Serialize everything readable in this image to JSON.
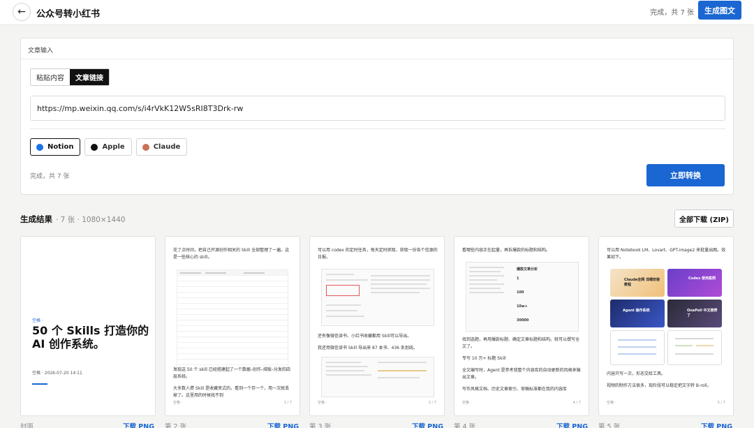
{
  "header": {
    "back_icon": "←",
    "title": "公众号转小红书",
    "status": "完成，共 7 张",
    "generate_label": "生成图文"
  },
  "input_panel": {
    "label": "文章输入",
    "modes": [
      "粘贴内容",
      "文章链接"
    ],
    "active_mode": "文章链接",
    "url_value": "https://mp.weixin.qq.com/s/i4rVkK12W5sRI8T3Drk-rw",
    "themes": [
      {
        "name": "Notion",
        "color": "#1a73e8",
        "active": true
      },
      {
        "name": "Apple",
        "color": "#111111",
        "active": false
      },
      {
        "name": "Claude",
        "color": "#c8735a",
        "active": false
      }
    ],
    "status": "完成，共 7 张",
    "convert_label": "立即转换"
  },
  "results": {
    "title": "生成结果",
    "meta": "· 7 张 · 1080×1440",
    "zip_label": "全部下载 (ZIP)",
    "download_label": "下载 PNG",
    "cards": [
      {
        "label": "封面",
        "tag": "空格 ·",
        "title": "50 个 Skills 打造你的 AI 创作系统。",
        "meta": "空格 · 2026-07-20 14:11"
      },
      {
        "label": "第 2 张",
        "text_top": "花了点时间，把自己开源创作相关的 Skill 全部整理了一遍。这是一些核心的 skill。",
        "text_bottom": "发现这 50 个 skill 已经搭建起了一个数据–创作–排版–分发的四层系统。",
        "text_bottom2": "大多数人攒 Skill 是收藏夹式的，看到一个存一个，用一次就丢掉了。这里用的时候找不到",
        "foot_l": "空格 ·",
        "foot_r": "2 / 7"
      },
      {
        "label": "第 3 张",
        "text_top": "可以用 codex 的定时任务，每天定时抓取、获取一份各个信源的日报。",
        "text_mid": "还有像微信读书、小红书收藏都用 Skill可以导出。",
        "text_mid2": "我还用微信读书 Skill 导出来 87 本书、436 条划线。",
        "foot_l": "空格 ·",
        "foot_r": "3 / 7"
      },
      {
        "label": "第 4 张",
        "text_top": "看哪些内容正在起量，再拆爆款的标题和结构。",
        "shot_title": "爆款文章分析",
        "stats": [
          "1",
          "100",
          "10w+",
          "30000"
        ],
        "text_mid": "找到选题，再用爆款标题、确定文章标题和结构。就可以撰写全文了。",
        "text_mid2": "专写 10 万+ 标题 Skill",
        "text_mid3": "全文编写时，Agent 是参考我整个内容库的自动更新的风格来输出文章。",
        "text_mid4": "写作风格文档、历史文章索引、审稿标准都在我的内容库",
        "foot_l": "空格 ·",
        "foot_r": "4 / 7"
      },
      {
        "label": "第 5 张",
        "text_top": "可以用 Notebook LM、Lovart、GPT-image2 来批量出图。效果如下。",
        "tiles": [
          "Claude全网 详细安装教程",
          "Codex 使用案例",
          "Agent 操作系统",
          "OnePoll 中文推荐了"
        ],
        "text_mid": "内容只写一次，形态交给工具。",
        "text_mid2": "视频的制作方法很多，现阶段可以稳定把文字转 B-roll。",
        "foot_l": "空格 ·",
        "foot_r": "5 / 7"
      }
    ]
  }
}
